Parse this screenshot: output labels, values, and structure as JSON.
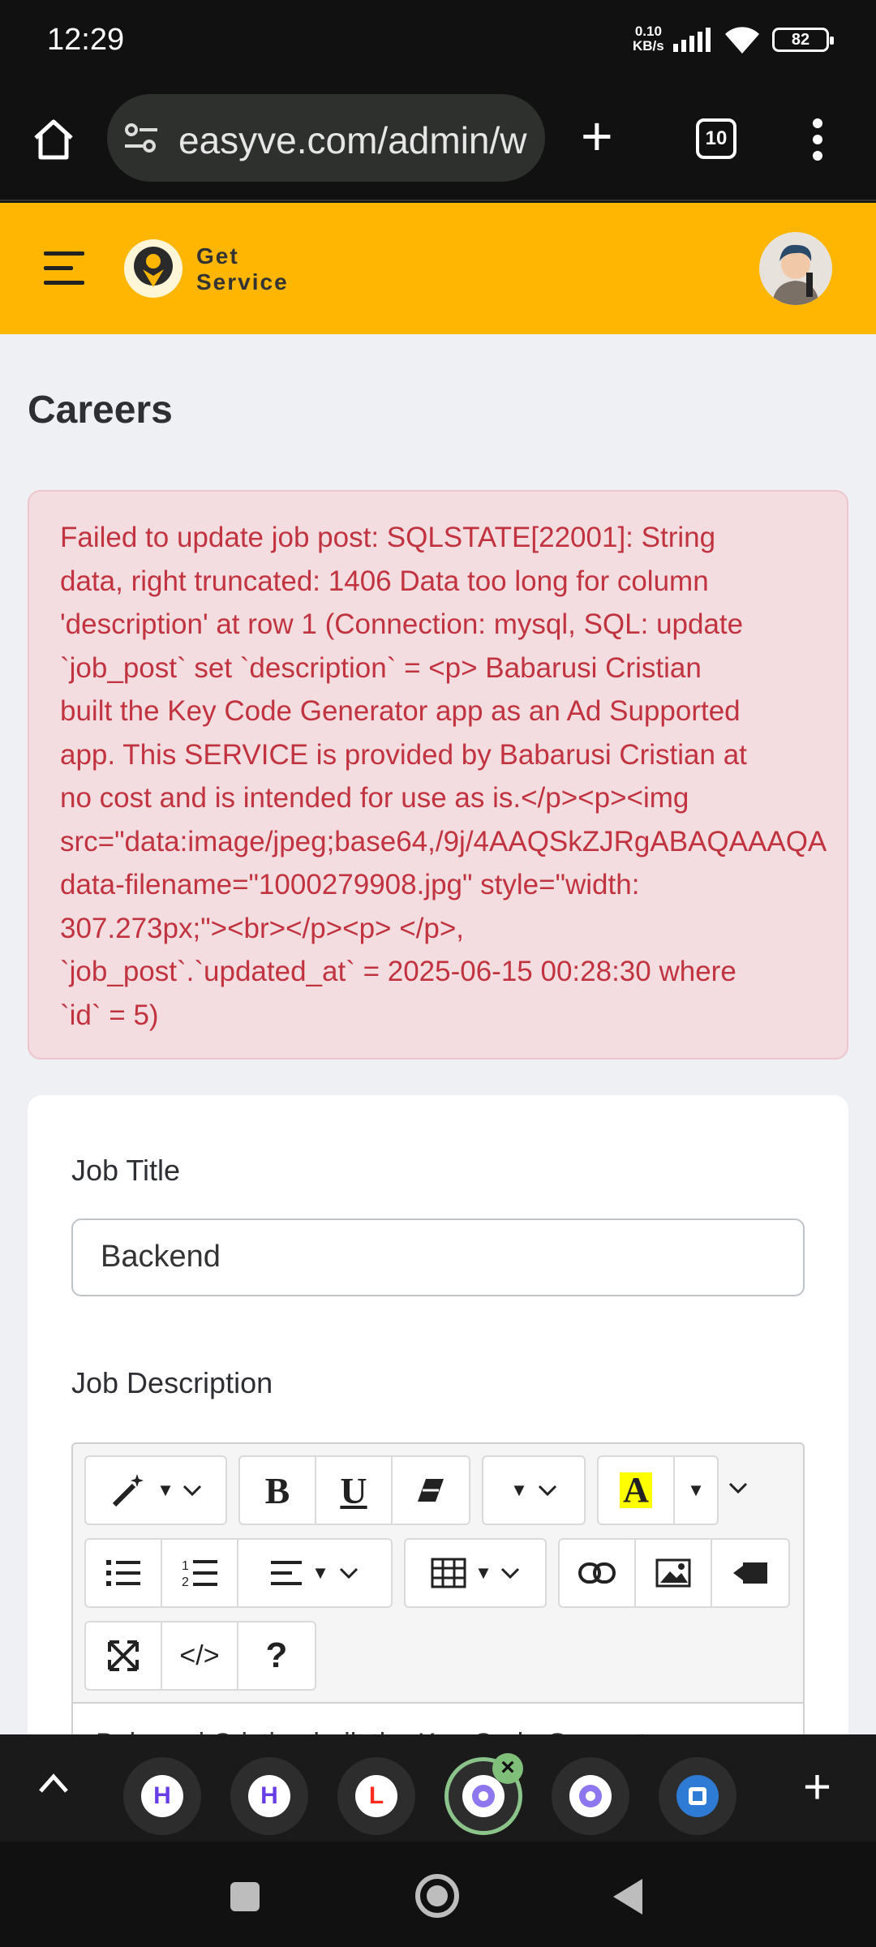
{
  "status_bar": {
    "time": "12:29",
    "net_speed_value": "0.10",
    "net_speed_unit": "KB/s",
    "battery": "82"
  },
  "browser": {
    "url": "easyve.com/admin/w",
    "tab_count": "10"
  },
  "header": {
    "logo_line1": "Get",
    "logo_line2": "Service"
  },
  "page": {
    "title": "Careers",
    "error_lines": [
      "Failed to update job post: SQLSTATE[22001]: String",
      "data, right truncated: 1406 Data too long for column",
      "'description' at row 1 (Connection: mysql, SQL: update",
      "`job_post` set `description` = <p> Babarusi Cristian",
      "built the Key Code Generator app as an Ad Supported",
      "app. This SERVICE is provided by Babarusi Cristian at",
      "no cost and is intended for use as is.</p><p><img",
      "src=\"data:image/jpeg;base64,/9j/4AAQSkZJRgABAQAAAQA",
      "data-filename=\"1000279908.jpg\" style=\"width:",
      "307.273px;\"><br></p><p> </p>,",
      "`job_post`.`updated_at` = 2025-06-15 00:28:30 where",
      "`id` = 5)"
    ]
  },
  "form": {
    "job_title_label": "Job Title",
    "job_title_value": "Backend",
    "job_description_label": "Job Description",
    "editor_preview": "Babarusi Cristian built the Key Code Generator app as",
    "toolbar": {
      "bold": "B",
      "underline": "U",
      "font_color": "A",
      "code_view": "</>",
      "help": "?"
    }
  },
  "tabs_strip": {
    "tabs": [
      {
        "icon": "hostinger-icon",
        "letter": "H",
        "color": "#673DE6"
      },
      {
        "icon": "hostinger-icon",
        "letter": "H",
        "color": "#673DE6"
      },
      {
        "icon": "laravel-icon",
        "letter": "L",
        "color": "#FF2D20"
      },
      {
        "icon": "swirl-icon",
        "letter": "",
        "color": "#7B5CE6",
        "active": true
      },
      {
        "icon": "swirl-icon",
        "letter": "",
        "color": "#7B5CE6"
      },
      {
        "icon": "app-icon",
        "letter": "",
        "color": "#2E7BD6"
      }
    ]
  }
}
